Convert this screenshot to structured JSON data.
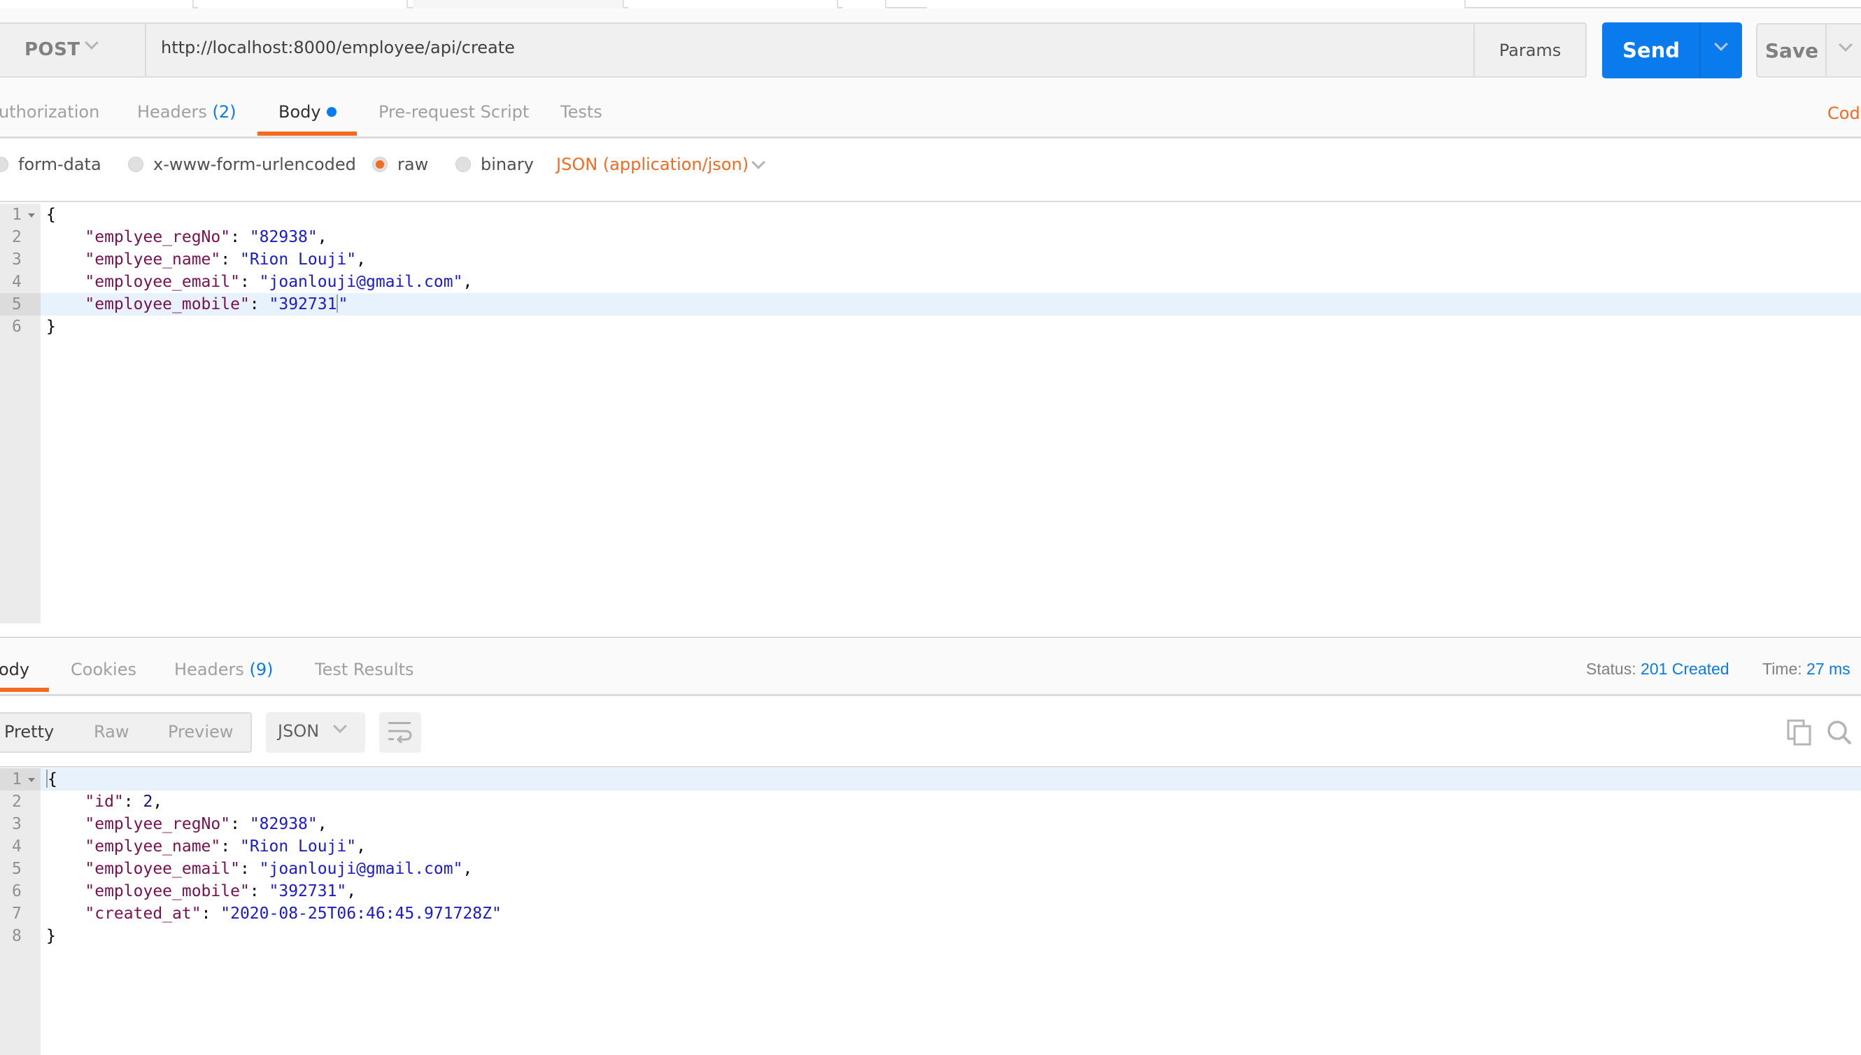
{
  "top_tabs": [
    "",
    "",
    "",
    "",
    "",
    ""
  ],
  "request": {
    "method": "POST",
    "url": "http://localhost:8000/employee/api/create",
    "params_label": "Params",
    "send_label": "Send",
    "save_label": "Save"
  },
  "request_tabs": [
    {
      "label": "uthorization",
      "count": "",
      "active": false
    },
    {
      "label": "Headers",
      "count": "(2)",
      "active": false
    },
    {
      "label": "Body",
      "count": "",
      "active": true,
      "modified_dot": true
    },
    {
      "label": "Pre-request Script",
      "count": "",
      "active": false
    },
    {
      "label": "Tests",
      "count": "",
      "active": false
    }
  ],
  "code_link": "Code",
  "body_modes": [
    {
      "label": "form-data",
      "selected": false
    },
    {
      "label": "x-www-form-urlencoded",
      "selected": false
    },
    {
      "label": "raw",
      "selected": true
    },
    {
      "label": "binary",
      "selected": false
    }
  ],
  "content_type": "JSON (application/json)",
  "request_body": {
    "lines": [
      {
        "n": "1",
        "text": "{"
      },
      {
        "n": "2",
        "key": "\"emplyee_regNo\"",
        "value": "\"82938\"",
        "trail": ","
      },
      {
        "n": "3",
        "key": "\"emplyee_name\"",
        "value": "\"Rion Louji\"",
        "trail": ","
      },
      {
        "n": "4",
        "key": "\"employee_email\"",
        "value": "\"joanlouji@gmail.com\"",
        "trail": ","
      },
      {
        "n": "5",
        "key": "\"employee_mobile\"",
        "value": "\"392731",
        "value_end": "\"",
        "trail": ""
      },
      {
        "n": "6",
        "text": "}"
      }
    ]
  },
  "response_tabs": [
    {
      "label": "ody",
      "count": "",
      "active": true
    },
    {
      "label": "Cookies",
      "count": "",
      "active": false
    },
    {
      "label": "Headers",
      "count": "(9)",
      "active": false
    },
    {
      "label": "Test Results",
      "count": "",
      "active": false
    }
  ],
  "response_meta": {
    "status_label": "Status:",
    "status_value": "201 Created",
    "time_label": "Time:",
    "time_value": "27 ms"
  },
  "response_views": [
    "Pretty",
    "Raw",
    "Preview"
  ],
  "response_format": "JSON",
  "response_body": {
    "lines": [
      {
        "n": "1",
        "text": "{"
      },
      {
        "n": "2",
        "key": "\"id\"",
        "number": "2",
        "trail": ","
      },
      {
        "n": "3",
        "key": "\"emplyee_regNo\"",
        "value": "\"82938\"",
        "trail": ","
      },
      {
        "n": "4",
        "key": "\"emplyee_name\"",
        "value": "\"Rion Louji\"",
        "trail": ","
      },
      {
        "n": "5",
        "key": "\"employee_email\"",
        "value": "\"joanlouji@gmail.com\"",
        "trail": ","
      },
      {
        "n": "6",
        "key": "\"employee_mobile\"",
        "value": "\"392731\"",
        "trail": ","
      },
      {
        "n": "7",
        "key": "\"created_at\"",
        "value": "\"2020-08-25T06:46:45.971728Z\"",
        "trail": ""
      },
      {
        "n": "8",
        "text": "}"
      }
    ]
  },
  "colors": {
    "accent_orange": "#f26b21",
    "send_blue": "#097bed",
    "json_key": "#7a1050",
    "json_string": "#1a1ad0"
  }
}
